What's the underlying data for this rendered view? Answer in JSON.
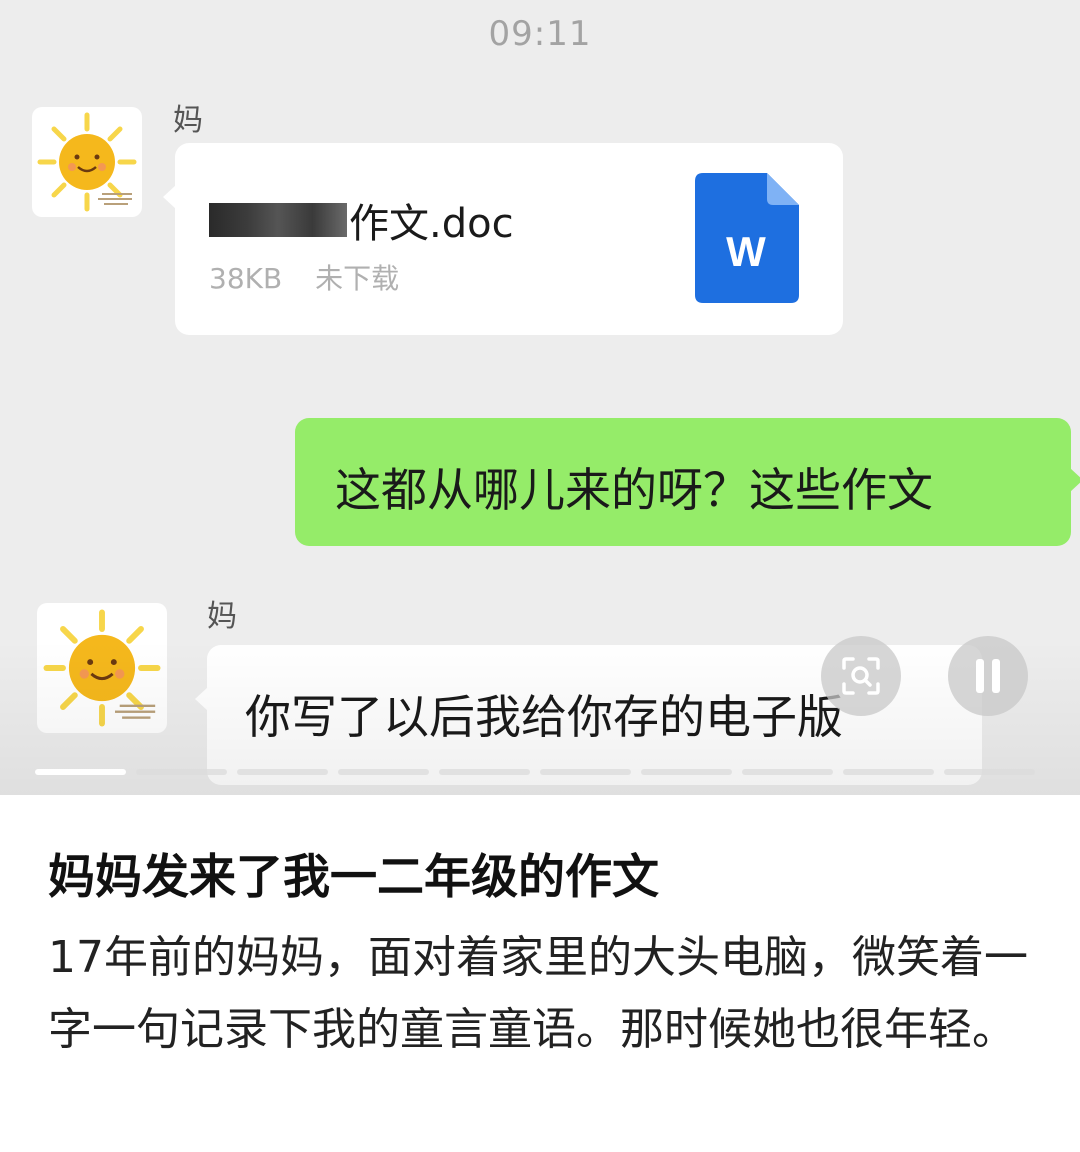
{
  "chat": {
    "timestamp": "09:11",
    "messages": [
      {
        "type": "file",
        "sender": "妈",
        "file_name": "作文.doc",
        "file_size": "38KB",
        "file_status": "未下载",
        "file_icon": "word-doc-icon",
        "file_icon_letter": "W"
      },
      {
        "type": "text",
        "direction": "sent",
        "text": "这都从哪儿来的呀？这些作文"
      },
      {
        "type": "text",
        "sender": "妈",
        "text": "你写了以后我给你存的电子版"
      }
    ],
    "avatar_icon": "sun-icon"
  },
  "overlay": {
    "scan_icon": "scan-icon",
    "pause_icon": "pause-icon",
    "progress_segments": 10,
    "active_segment": 1
  },
  "post": {
    "title": "妈妈发来了我一二年级的作文",
    "body": "17年前的妈妈，面对着家里的大头电脑，微笑着一字一句记录下我的童言童语。那时候她也很年轻。"
  },
  "colors": {
    "chat_bg": "#ededed",
    "sent_bubble": "#95ec69",
    "received_bubble": "#ffffff",
    "word_blue": "#1e6fe0"
  }
}
